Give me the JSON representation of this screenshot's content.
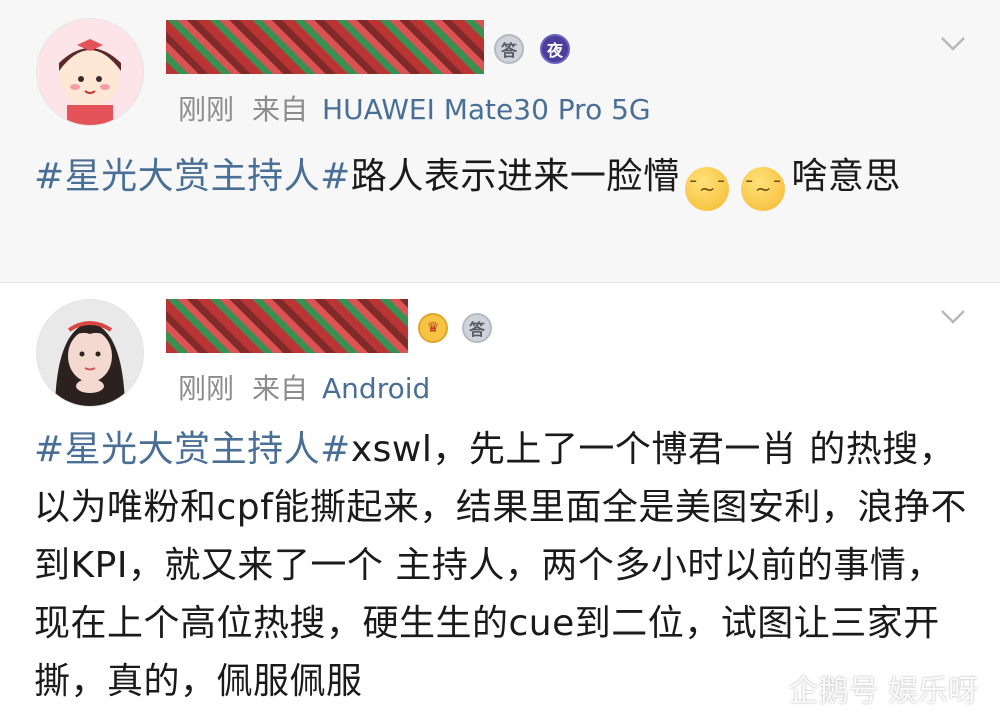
{
  "posts": [
    {
      "username": "",
      "time": "刚刚",
      "from_label": "来自",
      "device": "HUAWEI Mate30 Pro 5G",
      "badges": [
        {
          "icon": "silver-answer-badge",
          "text": "答"
        },
        {
          "icon": "night-badge",
          "text": "夜"
        }
      ],
      "topic": "#星光大赏主持人#",
      "text_before": "路人表示进来一脸懵",
      "emoji": "dizzy-face-emoji",
      "text_after": "啥意思"
    },
    {
      "username": "",
      "time": "刚刚",
      "from_label": "来自",
      "device": "Android",
      "badges": [
        {
          "icon": "crown-badge",
          "text": "♛"
        },
        {
          "icon": "silver-answer-badge",
          "text": "答"
        }
      ],
      "topic": "#星光大赏主持人#",
      "text": "xswl，先上了一个博君一肖 的热搜，以为唯粉和cpf能撕起来，结果里面全是美图安利，浪挣不到KPI，就又来了一个 主持人，两个多小时以前的事情，现在上个高位热搜，硬生生的cue到二位，试图让三家开撕，真的，佩服佩服"
    }
  ],
  "watermark": "企鹅号 娱乐呀",
  "colors": {
    "topic": "#4a6f96",
    "meta": "#8c8c8c",
    "background_top": "#f7f7f7"
  }
}
